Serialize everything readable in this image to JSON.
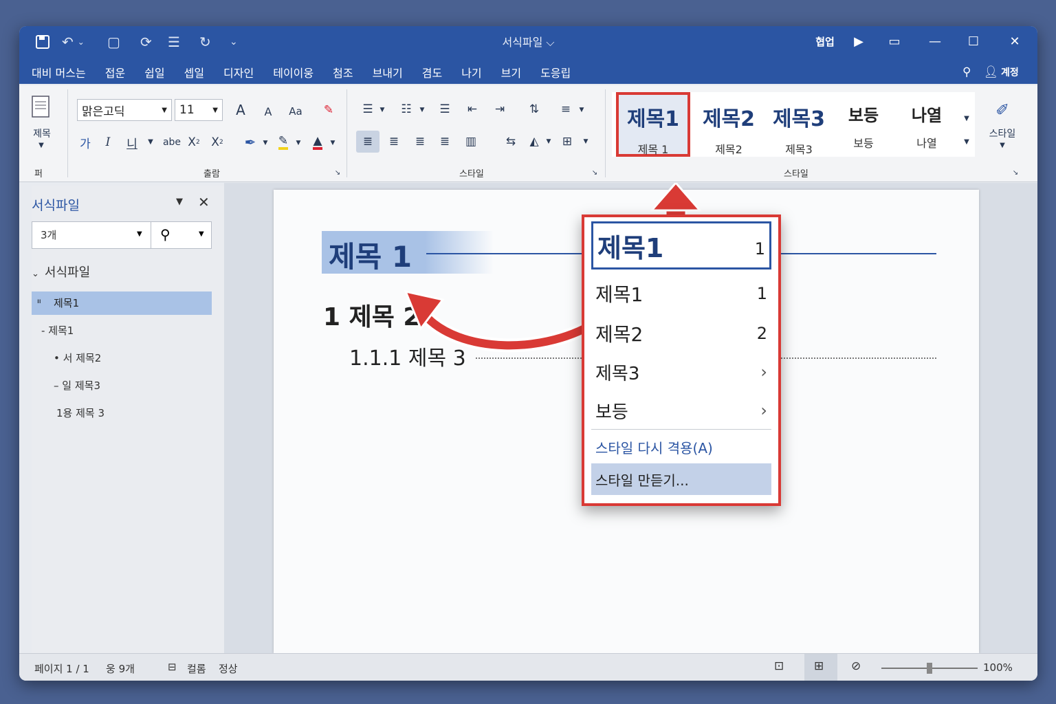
{
  "window": {
    "title": "서식파일 ⌵"
  },
  "titlebar": {
    "share": "협업",
    "minimize": "—",
    "maximize": "☐",
    "close": "✕"
  },
  "menubar": {
    "items": [
      "대비 머스는",
      "접운",
      "쉽일",
      "셉일",
      "디자인",
      "테이이웅",
      "첨조",
      "브내기",
      "겸도",
      "나기",
      "브기",
      "도응립"
    ],
    "account": "계정"
  },
  "ribbon": {
    "paste_label": "제목",
    "clipboard_group": "퍼",
    "font_name": "맑은고딕",
    "font_size": "11",
    "font_group": "출람",
    "para_group": "스타일",
    "styles_group": "스타일",
    "bold": "가",
    "italic": "I",
    "underline": "니",
    "strike": "abe",
    "styles_button": "스타일",
    "grow": "A",
    "shrink": "A",
    "case": "Aa"
  },
  "gallery": [
    {
      "big": "제목1",
      "small": "제목 1"
    },
    {
      "big": "제목2",
      "small": "제목2"
    },
    {
      "big": "제목3",
      "small": "제목3"
    },
    {
      "big": "보등",
      "small": "보등"
    },
    {
      "big": "나열",
      "small": "나열"
    }
  ],
  "navpane": {
    "title": "서식파일",
    "search_value": "3개",
    "root": "서식파일",
    "items": [
      "제목1",
      "제목1",
      "서 제목2",
      "일 제목3",
      "1용 제목 3"
    ]
  },
  "document": {
    "h1": "제목 1",
    "h2": "1 제목 2",
    "h3": "1.1.1 제목 3"
  },
  "context_menu": {
    "items": [
      {
        "label": "제목1",
        "right": "1"
      },
      {
        "label": "제목1",
        "right": "1"
      },
      {
        "label": "제목2",
        "right": "2"
      },
      {
        "label": "제목3",
        "right": "›"
      },
      {
        "label": "보등",
        "right": "›"
      }
    ],
    "reapply": "스타일 다시 격용(A)",
    "create": "스타일 만듣기..."
  },
  "statusbar": {
    "page": "페이지 1 / 1",
    "words": "웅 9개",
    "mode": "컬롬",
    "state": "정상",
    "zoom": "100%",
    "zoom_level": 0.5
  },
  "colors": {
    "titlebar": "#2b55a3",
    "accent": "#d93a35",
    "highlight": "#a9c2e6"
  }
}
